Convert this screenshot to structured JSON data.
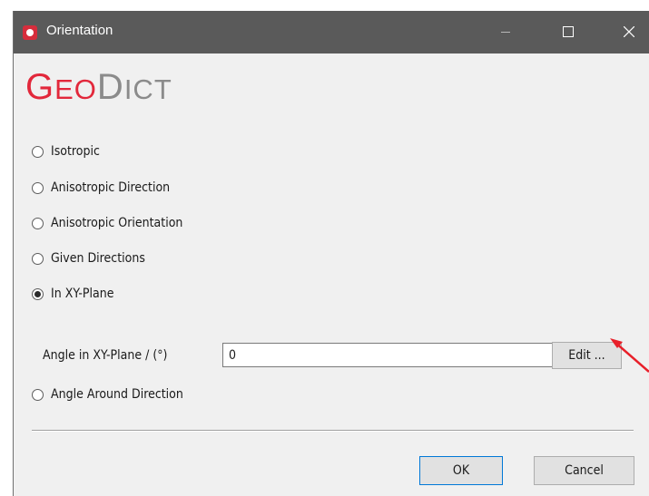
{
  "window": {
    "title": "Orientation",
    "icon": "geodict-app-icon"
  },
  "logo": {
    "geo_first": "G",
    "geo_rest": "EO",
    "dict_first": "D",
    "dict_rest": "ICT"
  },
  "options": [
    {
      "label": "Isotropic",
      "checked": false
    },
    {
      "label": "Anisotropic Direction",
      "checked": false
    },
    {
      "label": "Anisotropic Orientation",
      "checked": false
    },
    {
      "label": "Given Directions",
      "checked": false
    },
    {
      "label": "In XY-Plane",
      "checked": true
    },
    {
      "label": "Angle Around Direction",
      "checked": false
    }
  ],
  "angle": {
    "label": "Angle in XY-Plane / (°)",
    "value": "0",
    "edit_label": "Edit ..."
  },
  "footer": {
    "ok_label": "OK",
    "cancel_label": "Cancel"
  },
  "colors": {
    "titlebar": "#5a5a5a",
    "brand_red": "#e2283b",
    "annotation_arrow": "#e8202a"
  }
}
